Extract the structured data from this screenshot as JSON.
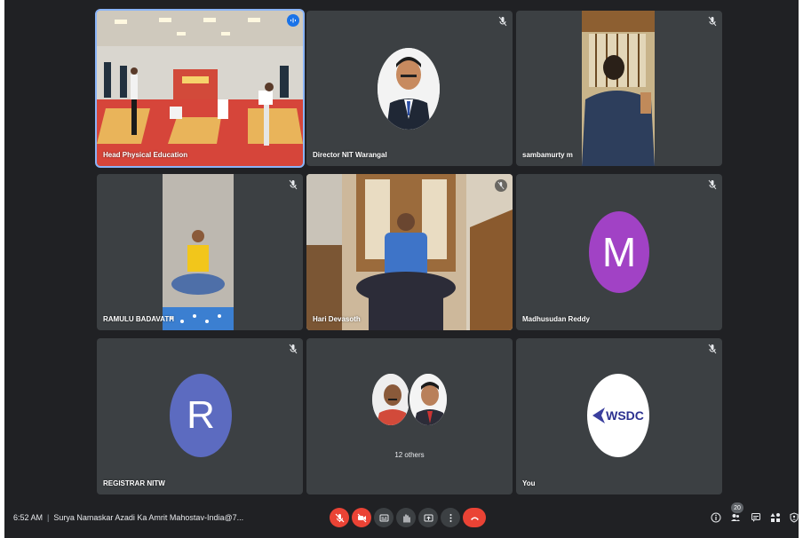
{
  "meeting": {
    "time": "6:52 AM",
    "title": "Surya Namaskar Azadi Ka Amrit Mahostav-India@7...",
    "participant_count": "20",
    "others_label": "12 others"
  },
  "participants": [
    {
      "name": "Head Physical Education",
      "muted": false,
      "speaking": true
    },
    {
      "name": "Director NIT Warangal",
      "muted": true
    },
    {
      "name": "sambamurty m",
      "muted": true
    },
    {
      "name": "RAMULU BADAVATH",
      "muted": true
    },
    {
      "name": "Hari Devasoth",
      "muted": true
    },
    {
      "name": "Madhusudan Reddy",
      "muted": true,
      "avatar_letter": "M",
      "avatar_color": "#a142c5"
    },
    {
      "name": "REGISTRAR NITW",
      "muted": true,
      "avatar_letter": "R",
      "avatar_color": "#5c6bc0"
    },
    {
      "name": "You",
      "muted": true,
      "logo_text": "WSDC"
    }
  ],
  "banner_text": "SURYA NAMASKAR",
  "controls": {
    "mic": "mic-off-icon",
    "camera": "camera-off-icon",
    "captions": "captions-icon",
    "raise_hand": "raise-hand-icon",
    "present": "present-icon",
    "more": "more-options-icon",
    "end_call": "end-call-icon"
  },
  "colors": {
    "background": "#202124",
    "tile": "#3c4043",
    "danger": "#ea4335",
    "active_outline": "#8ab4f8"
  }
}
